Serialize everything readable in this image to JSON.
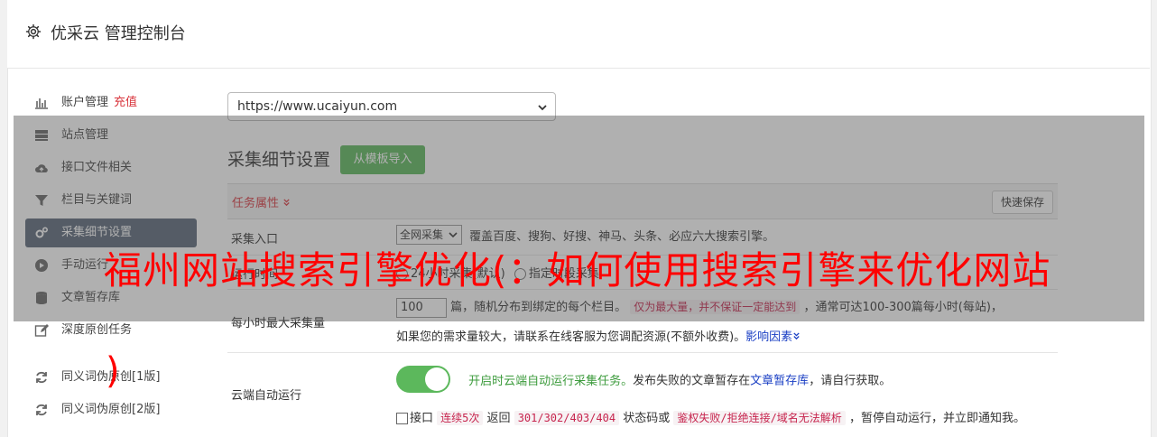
{
  "header": {
    "title": "优采云 管理控制台",
    "icon": "gear-icon"
  },
  "sidebar": {
    "items": [
      {
        "label": "账户管理",
        "extra": "充值",
        "icon": "bar-chart-icon"
      },
      {
        "label": "站点管理",
        "icon": "server-icon"
      },
      {
        "label": "接口文件相关",
        "icon": "cloud-upload-icon"
      },
      {
        "label": "栏目与关键词",
        "icon": "filter-icon"
      },
      {
        "label": "采集细节设置",
        "icon": "gears-icon",
        "active": true
      },
      {
        "label": "手动运行",
        "icon": "play-circle-icon"
      },
      {
        "label": "文章暂存库",
        "icon": "database-icon"
      },
      {
        "label": "深度原创任务",
        "icon": "edit-icon"
      },
      {
        "label": "同义词伪原创[1版]",
        "icon": "refresh-icon"
      },
      {
        "label": "同义词伪原创[2版]",
        "icon": "refresh-icon"
      }
    ]
  },
  "site_select": {
    "value": "https://www.ucaiyun.com"
  },
  "section": {
    "title": "采集细节设置",
    "import_button": "从模板导入",
    "attr_label": "任务属性 ",
    "quick_save": "快速保存"
  },
  "rows": {
    "entry": {
      "label": "采集入口",
      "select_value": "全网采集",
      "desc": "覆盖百度、搜狗、好搜、神马、头条、必应六大搜索引擎。"
    },
    "time": {
      "label": "运行时间",
      "option1": "24小时采集(默认)",
      "option2": "指定时段采集"
    },
    "hourly": {
      "label": "每小时最大采集量",
      "value": "100",
      "text1": "篇，随机分布到绑定的每个栏目。",
      "code": "仅为最大量，并不保证一定能达到",
      "text2": "，通常可达100-300篇每小时(每站)，",
      "text3": "如果您的需求量较大，请联系在线客服为您调配资源(不额外收费)。",
      "link": "影响因素"
    },
    "cloud": {
      "label": "云端自动运行",
      "toggle_text": "开启时云端自动运行采集任务。",
      "text1": "发布失败的文章暂存在",
      "link": "文章暂存库",
      "text2": "，请自行获取。",
      "check_prefix": "接口",
      "code1": "连续5次",
      "mid1": "返回",
      "code2": "301/302/403/404",
      "mid2": "状态码或",
      "code3": "鉴权失败/拒绝连接/域名无法解析",
      "tail": "，暂停自动运行，并立即通知我。"
    }
  },
  "overlay": {
    "headline": "福州网站搜索引擎优化(：如何使用搜索引擎来优化网站",
    "paren": ")"
  },
  "colors": {
    "accent_green": "#5cb85c",
    "nav_active": "#596678",
    "danger": "#d9363e",
    "headline": "#ff0000"
  }
}
